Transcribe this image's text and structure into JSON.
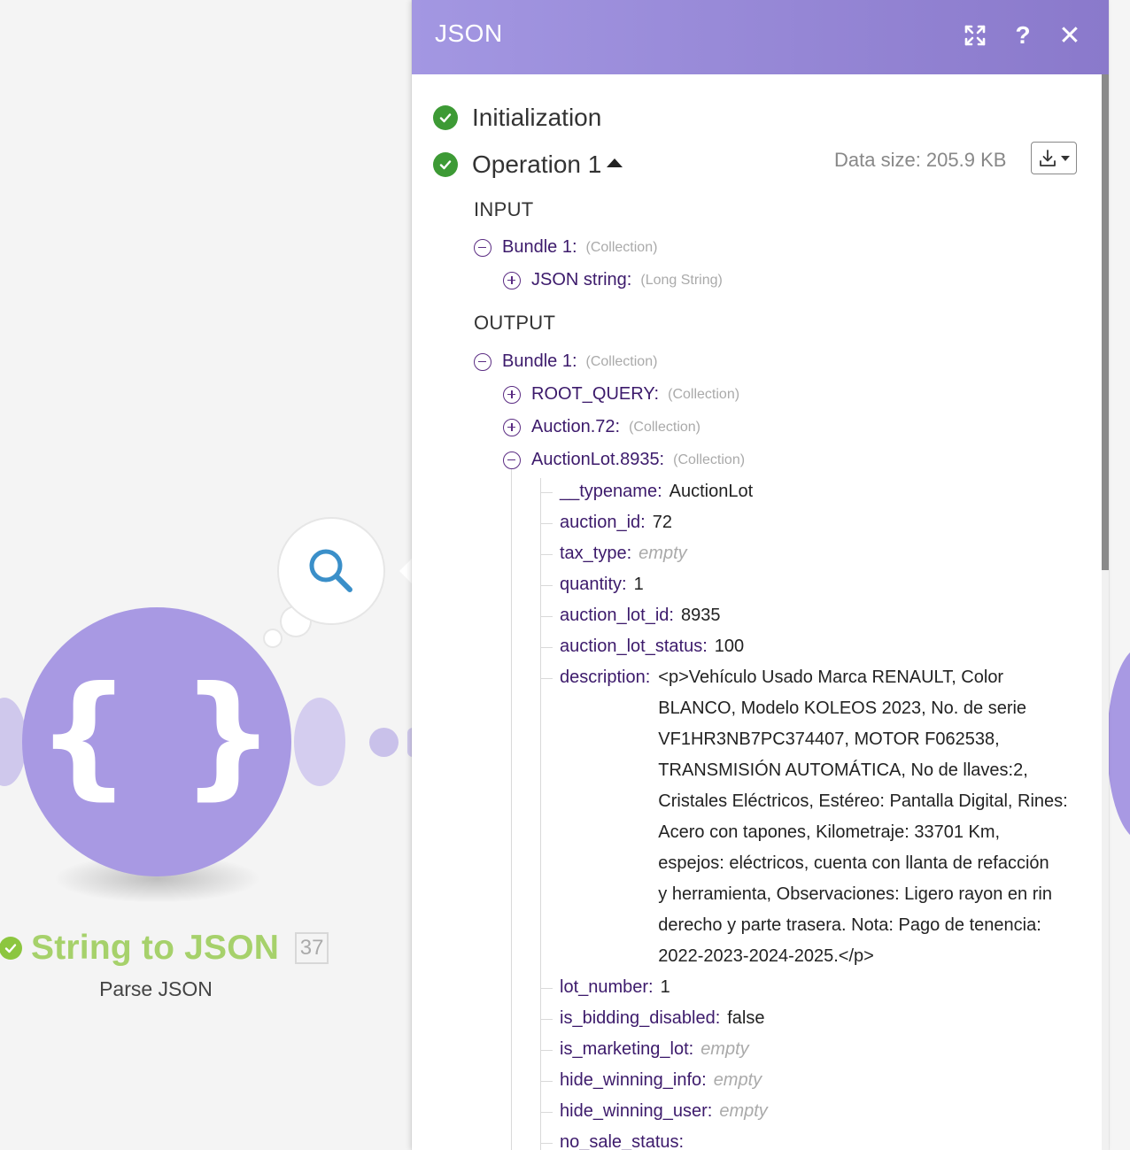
{
  "module": {
    "title": "String to JSON",
    "id_badge": "37",
    "subtitle": "Parse JSON",
    "glyph": "{ }",
    "color_primary": "#a899e3",
    "status_color": "#8cc63f",
    "icon": "braces-icon"
  },
  "panel": {
    "title": "JSON",
    "header_gradient": [
      "#a397e2",
      "#8a79cb"
    ],
    "icons": [
      "expand-icon",
      "help-icon",
      "close-icon"
    ],
    "help_label": "?",
    "close_label": "✕"
  },
  "operations": {
    "initialization": "Initialization",
    "operation_label": "Operation 1",
    "data_size": "Data size: 205.9 KB"
  },
  "input": {
    "heading": "INPUT",
    "bundle_key": "Bundle 1:",
    "bundle_type": "(Collection)",
    "json_string_key": "JSON string:",
    "json_string_type": "(Long String)"
  },
  "output": {
    "heading": "OUTPUT",
    "bundle_key": "Bundle 1:",
    "bundle_type": "(Collection)",
    "root_query_key": "ROOT_QUERY:",
    "root_query_type": "(Collection)",
    "auction_key": "Auction.72:",
    "auction_type": "(Collection)",
    "lot_key": "AuctionLot.8935:",
    "lot_type": "(Collection)",
    "fields": {
      "typename": {
        "key": "__typename:",
        "value": "AuctionLot"
      },
      "auction_id": {
        "key": "auction_id:",
        "value": "72"
      },
      "tax_type": {
        "key": "tax_type:",
        "value": "empty"
      },
      "quantity": {
        "key": "quantity:",
        "value": "1"
      },
      "auction_lot_id": {
        "key": "auction_lot_id:",
        "value": "8935"
      },
      "auction_lot_status": {
        "key": "auction_lot_status:",
        "value": "100"
      },
      "description": {
        "key": "description:",
        "lines": [
          "<p>Vehículo Usado Marca RENAULT, Color",
          "BLANCO, Modelo KOLEOS 2023,  No. de serie",
          "VF1HR3NB7PC374407, MOTOR F062538,",
          "TRANSMISIÓN  AUTOMÁTICA, No de llaves:2,",
          "Cristales Eléctricos, Estéreo: Pantalla Digital, Rines:",
          "Acero con tapones, Kilometraje: 33701 Km,",
          "espejos: eléctricos, cuenta con llanta de refacción",
          "y herramienta, Observaciones: Ligero rayon en rin",
          "derecho y parte trasera.  Nota: Pago de tenencia:",
          "2022-2023-2024-2025.</p>"
        ]
      },
      "lot_number": {
        "key": "lot_number:",
        "value": "1"
      },
      "is_bidding_disabled": {
        "key": "is_bidding_disabled:",
        "value": "false"
      },
      "is_marketing_lot": {
        "key": "is_marketing_lot:",
        "value": "empty"
      },
      "hide_winning_info": {
        "key": "hide_winning_info:",
        "value": "empty"
      },
      "hide_winning_user": {
        "key": "hide_winning_user:",
        "value": "empty"
      },
      "no_sale_status": {
        "key": "no_sale_status:",
        "value": ""
      }
    }
  }
}
